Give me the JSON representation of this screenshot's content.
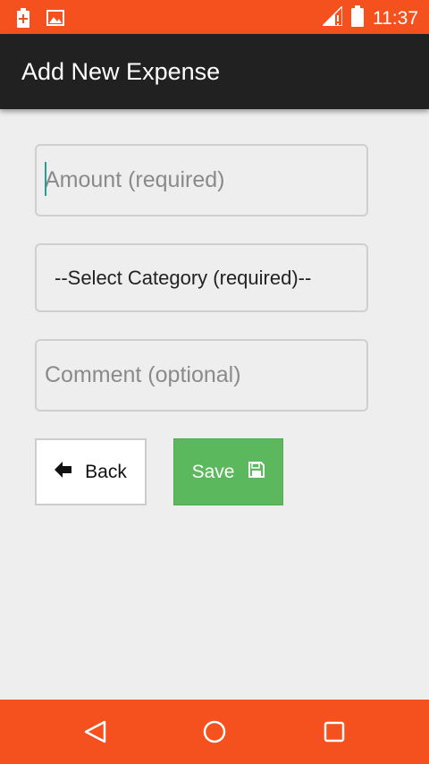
{
  "status_bar": {
    "time": "11:37",
    "background": "#f4511e",
    "icons": [
      "battery-saver-icon",
      "image-icon",
      "signal-icon",
      "battery-icon"
    ]
  },
  "app_bar": {
    "title": "Add New Expense",
    "background": "#212121"
  },
  "form": {
    "amount": {
      "placeholder": "Amount (required)",
      "value": ""
    },
    "category": {
      "selected": "--Select Category (required)--"
    },
    "comment": {
      "placeholder": "Comment (optional)",
      "value": ""
    }
  },
  "buttons": {
    "back_label": "Back",
    "back_icon": "arrow-left-icon",
    "save_label": "Save",
    "save_icon": "floppy-disk-icon",
    "save_color": "#5cb85c"
  },
  "nav_bar": {
    "background": "#f4511e",
    "icons": [
      "back-triangle-icon",
      "home-circle-icon",
      "recents-square-icon"
    ]
  }
}
